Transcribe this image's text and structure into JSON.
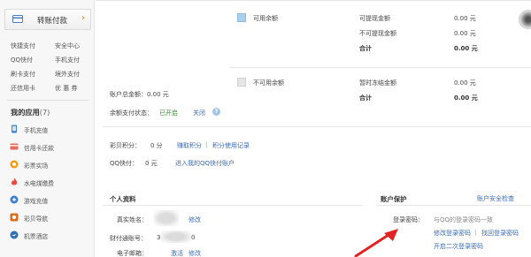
{
  "sidebar": {
    "transfer_label": "转账付款",
    "quick_links": [
      "快捷支付",
      "安全中心",
      "QQ快付",
      "手机支付",
      "刷卡支付",
      "境外支付",
      "还信用卡",
      "优 惠 券"
    ],
    "apps_title": "我的应用",
    "apps_count": "(7)",
    "apps": [
      {
        "label": "手机充值",
        "icon": "phone-icon",
        "color": "#3d7fd1"
      },
      {
        "label": "信用卡还款",
        "icon": "credit-card-icon",
        "color": "#e46a5a"
      },
      {
        "label": "彩票实场",
        "icon": "lottery-icon",
        "color": "#f39c12"
      },
      {
        "label": "水电煤缴费",
        "icon": "utility-flame-icon",
        "color": "#e74c3c"
      },
      {
        "label": "游戏充值",
        "icon": "game-icon",
        "color": "#3d7fd1"
      },
      {
        "label": "彩贝导航",
        "icon": "navigation-icon",
        "color": "#e06a1a"
      },
      {
        "label": "机票酒店",
        "icon": "flight-hotel-icon",
        "color": "#2f6fb5"
      }
    ]
  },
  "balance": {
    "available_label": "可用余额",
    "unavailable_label": "不可用余额",
    "withdrawable_label": "可提现金额",
    "withdrawable_value": "0.00 元",
    "non_withdrawable_label": "不可提现金额",
    "non_withdrawable_value": "0.00 元",
    "total_label": "合计",
    "total_value": "0.00 元",
    "frozen_label": "暂时冻结金额",
    "frozen_value": "0.00 元",
    "frozen_total_label": "合计",
    "frozen_total_value": "0.00 元",
    "account_total": "账户总金额：0.00 元",
    "pay_status_label": "余额支付状态：",
    "pay_status_value": "已开启",
    "close_link": "关闭",
    "available_color": "#a9d1ee",
    "unavailable_color": "#e6e6e6"
  },
  "points": {
    "caibei_label": "彩贝积分：",
    "caibei_value": "0 分",
    "earn_link": "赚取积分",
    "history_link": "积分使用记录",
    "separator": "|",
    "qq_label": "QQ快付：",
    "qq_value": "0 元",
    "qq_link": "进入我的QQ快付账户"
  },
  "profile": {
    "title": "个人资料",
    "name_label": "真实姓名：",
    "name_link": "修改",
    "card_label": "财付通账号：",
    "card_value": "3",
    "card_suffix": "0",
    "email_label": "电子邮箱：",
    "email_activate": "激活",
    "email_edit": "修改"
  },
  "security": {
    "title": "账户保护",
    "center_link": "账户安全检查",
    "login_label": "登录密码：",
    "login_desc": "与QQ的登录密码一致",
    "edit_link": "修改登录密码",
    "separator": "|",
    "reset_link": "找回登录密码",
    "second_link": "开启二次登录密码"
  }
}
